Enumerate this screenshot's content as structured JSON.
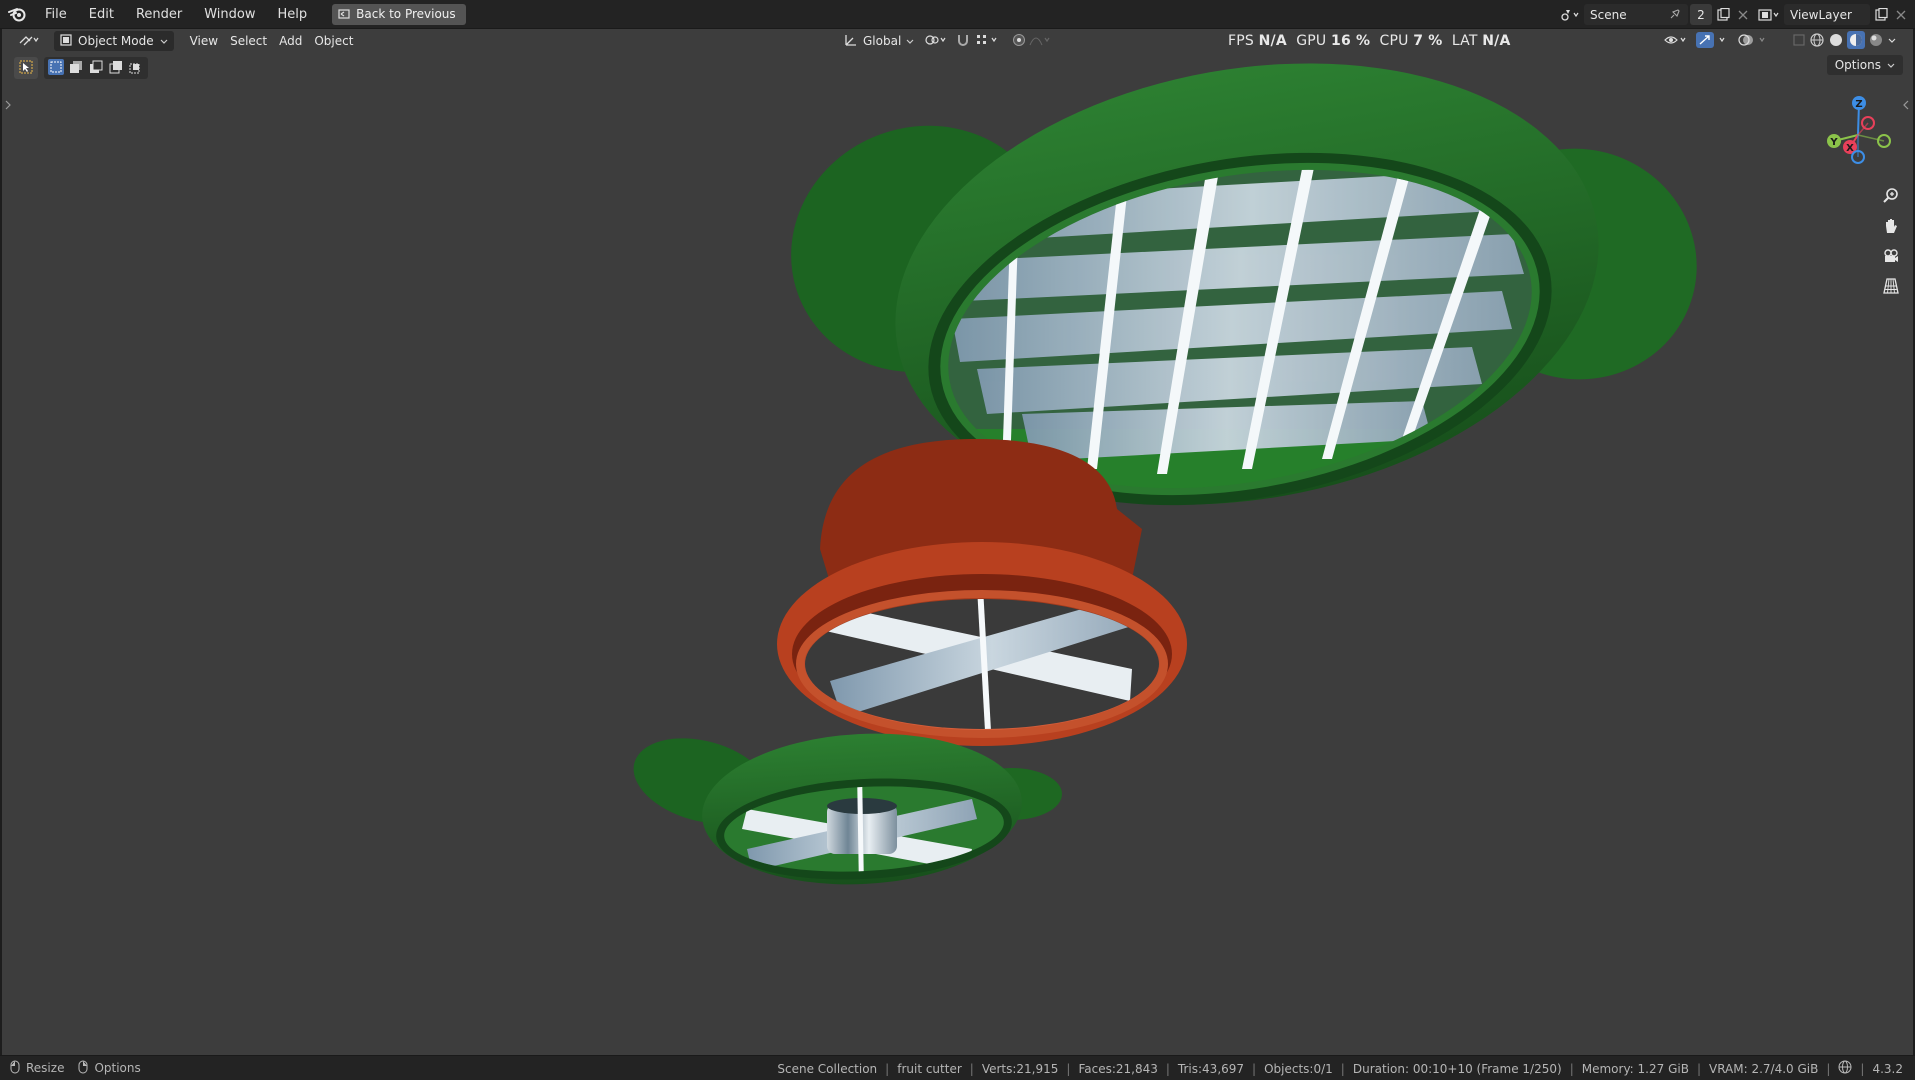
{
  "menu": {
    "items": [
      "File",
      "Edit",
      "Render",
      "Window",
      "Help"
    ],
    "back_button": "Back to Previous"
  },
  "top_right": {
    "scene_label": "Scene",
    "scene_count": "2",
    "view_layer": "ViewLayer"
  },
  "viewport_header": {
    "mode": "Object Mode",
    "menus": [
      "View",
      "Select",
      "Add",
      "Object"
    ],
    "transform_orientation": "Global",
    "options_label": "Options"
  },
  "stats": {
    "fps_label": "FPS",
    "fps_value": "N/A",
    "gpu_label": "GPU",
    "gpu_value": "16 %",
    "cpu_label": "CPU",
    "cpu_value": "7 %",
    "lat_label": "LAT",
    "lat_value": "N/A"
  },
  "gizmo": {
    "x": "X",
    "y": "Y",
    "z": "Z",
    "colors": {
      "x": "#e8405a",
      "y": "#8bc34a",
      "z": "#3d8ee6"
    }
  },
  "nav_icons": [
    "zoom-icon",
    "pan-hand-icon",
    "camera-icon",
    "grid-perspective-icon"
  ],
  "statusbar": {
    "left": [
      "Resize",
      "Options"
    ],
    "collection": "Scene Collection",
    "object": "fruit cutter",
    "verts": "Verts:21,915",
    "faces": "Faces:21,843",
    "tris": "Tris:43,697",
    "objects": "Objects:0/1",
    "duration": "Duration: 00:10+10 (Frame 1/250)",
    "memory": "Memory: 1.27 GiB",
    "vram": "VRAM: 2.7/4.0 GiB",
    "version": "4.3.2"
  },
  "colors": {
    "viewport_bg": "#3d3d3d",
    "green": "#1f6b24",
    "red": "#b5401f",
    "accent_blue": "#4772b3"
  }
}
